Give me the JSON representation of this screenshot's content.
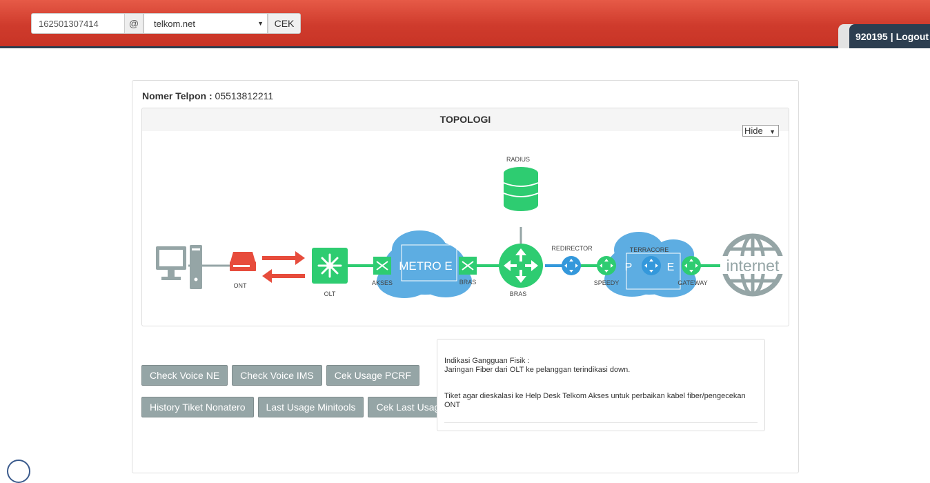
{
  "header": {
    "number_value": "162501307414",
    "at_symbol": "@",
    "domain_selected": "telkom.net",
    "cek_label": "CEK",
    "user_id": "920195",
    "separator": "|",
    "logout_label": "Logout"
  },
  "main": {
    "phone_label": "Nomer Telpon :",
    "phone_value": "05513812211",
    "topology": {
      "title": "TOPOLOGI",
      "hide_select": "Hide",
      "nodes": {
        "ont": "ONT",
        "olt": "OLT",
        "akses": "AKSES",
        "metro": "METRO E",
        "bras_switch": "BRAS",
        "radius": "RADIUS",
        "bras": "BRAS",
        "redirector": "REDIRECTOR",
        "speedy": "SPEEDY",
        "pe_p": "P",
        "pe_e": "E",
        "terracore": "TERRACORE",
        "gateway": "GATEWAY",
        "internet": "internet"
      },
      "colors": {
        "green": "#2ecc71",
        "red": "#e74c3c",
        "blue": "#3498db",
        "cloud": "#5dade2",
        "gray": "#95a5a6"
      }
    },
    "buttons_row1": [
      "Check Voice NE",
      "Check Voice IMS",
      "Cek Usage PCRF"
    ],
    "buttons_row2": [
      "History Tiket Nonatero",
      "Last Usage Minitools",
      "Cek Last Usage"
    ],
    "info": {
      "line1": "Indikasi Gangguan Fisik :",
      "line2": "Jaringan Fiber dari OLT ke pelanggan terindikasi down.",
      "line3": "Tiket agar dieskalasi ke Help Desk Telkom Akses untuk perbaikan kabel fiber/pengecekan ONT"
    }
  }
}
